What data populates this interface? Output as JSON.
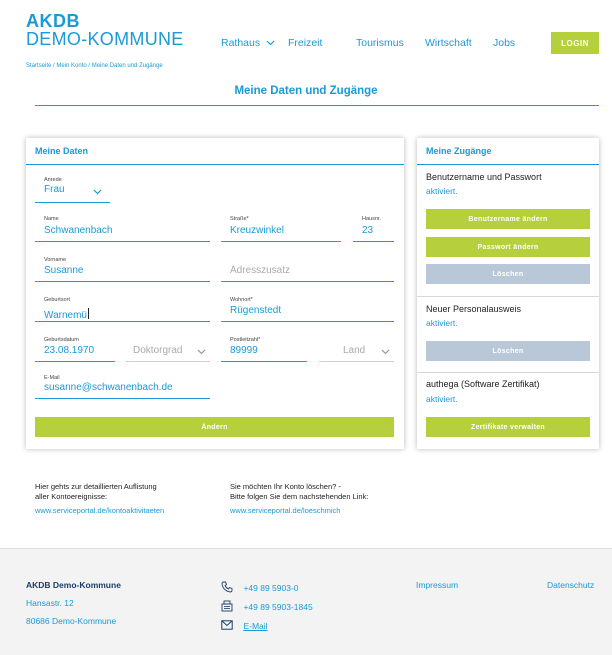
{
  "header": {
    "logo_top": "AKDB",
    "logo_bottom": "DEMO-KOMMUNE",
    "nav": [
      "Rathaus",
      "Freizeit",
      "Tourismus",
      "Wirtschaft",
      "Jobs"
    ],
    "login": "LOGIN"
  },
  "breadcrumb": "Startseite / Mein Konto / Meine Daten und Zugänge",
  "page_title": "Meine Daten und Zugänge",
  "meine_daten": {
    "title": "Meine Daten",
    "anrede_label": "Anrede",
    "anrede_value": "Frau",
    "name_label": "Name",
    "name_value": "Schwanenbach",
    "strasse_label": "Straße*",
    "strasse_value": "Kreuzwinkel",
    "hausnr_label": "Hausnr.",
    "hausnr_value": "23",
    "vorname_label": "Vorname",
    "vorname_value": "Susanne",
    "adresszusatz_placeholder": "Adresszusatz",
    "geburtsort_label": "Geburtsort",
    "geburtsort_value": "Warnemü",
    "wohnort_label": "Wohnort*",
    "wohnort_value": "Rügenstedt",
    "geburtsdatum_label": "Geburtsdatum",
    "geburtsdatum_value": "23.08.1970",
    "doktorgrad_placeholder": "Doktorgrad",
    "plz_label": "Postleitzahl*",
    "plz_value": "89999",
    "land_placeholder": "Land",
    "email_label": "E-Mail",
    "email_value": "susanne@schwanenbach.de",
    "submit": "Ändern"
  },
  "zugaenge": {
    "title": "Meine Zugänge",
    "section1_title": "Benutzername und Passwort",
    "section1_status": "aktiviert.",
    "btn_username": "Benutzername ändern",
    "btn_password": "Passwort ändern",
    "btn_delete1": "Löschen",
    "section2_title": "Neuer Personalausweis",
    "section2_status": "aktiviert.",
    "btn_delete2": "Löschen",
    "section3_title": "authega (Software Zertifikat)",
    "section3_status": "aktiviert.",
    "btn_certs": "Zertifikate verwalten"
  },
  "info": {
    "left_line1": "Hier gehts zur detaillierten Auflistung",
    "left_line2": "aller Kontoereignisse:",
    "left_link": "www.serviceportal.de/kontoaktivitaeten",
    "right_line1": "Sie möchten Ihr Konto löschen? -",
    "right_line2": "Bitte folgen Sie dem nachstehenden Link:",
    "right_link": "www.serviceportal.de/loeschmich"
  },
  "footer": {
    "org": "AKDB Demo-Kommune",
    "street": "Hansastr. 12",
    "city": "80686 Demo-Kommune",
    "phone": "+49 89 5903-0",
    "fax": "+49 89 5903-1845",
    "email": "E-Mail",
    "impressum": "Impressum",
    "datenschutz": "Datenschutz"
  },
  "colors": {
    "accent": "#1a9ad6",
    "button_green": "#b6cf3c",
    "button_grey": "#b9c8d8",
    "footer_bg": "#f3f3f3"
  }
}
